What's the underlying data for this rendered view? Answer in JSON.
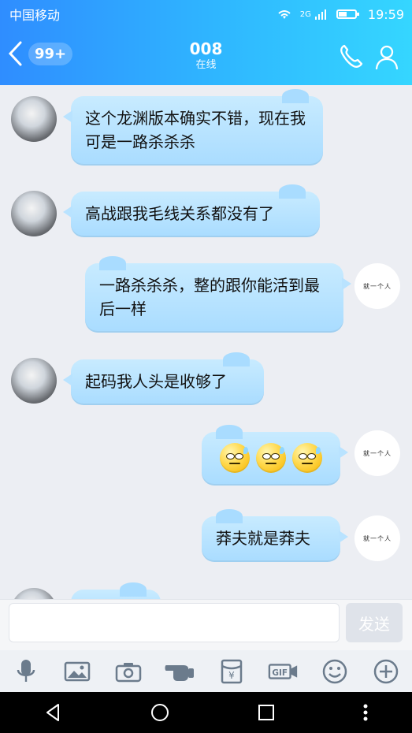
{
  "status": {
    "carrier": "中国移动",
    "signal_label": "2G",
    "time": "19:59"
  },
  "header": {
    "unread_badge": "99+",
    "title": "008",
    "subtitle": "在线"
  },
  "messages": [
    {
      "side": "left",
      "text": "这个龙渊版本确实不错，现在我可是一路杀杀杀"
    },
    {
      "side": "left",
      "text": "高战跟我毛线关系都没有了"
    },
    {
      "side": "right",
      "text": "一路杀杀杀，整的跟你能活到最后一样",
      "avatar_text": "就一个人"
    },
    {
      "side": "left",
      "text": "起码我人头是收够了"
    },
    {
      "side": "right",
      "emoji_count": 3,
      "avatar_text": "就一个人"
    },
    {
      "side": "right",
      "text": "莽夫就是莽夫",
      "avatar_text": "就一个人"
    }
  ],
  "input": {
    "value": "",
    "placeholder": ""
  },
  "buttons": {
    "send": "发送"
  },
  "toolbar": {
    "items": [
      "mic-icon",
      "image-icon",
      "camera-icon",
      "poke-icon",
      "red-packet-icon",
      "gif-icon",
      "emoji-icon",
      "plus-icon"
    ],
    "gif_label": "GIF",
    "redpacket_symbol": "¥"
  },
  "colors": {
    "header_start": "#2f8dff",
    "header_end": "#35d6ff",
    "bubble": "#a9dcff",
    "background": "#eceef3"
  }
}
